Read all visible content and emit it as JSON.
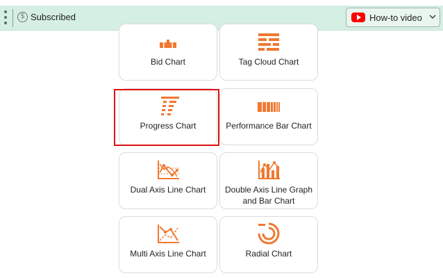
{
  "topbar": {
    "subscribed_label": "Subscribed",
    "subscribed_icon_glyph": "$",
    "howto_label": "How-to video"
  },
  "colors": {
    "accent": "#f07830",
    "topbar_bg": "#d5efe2",
    "selection": "#e01010",
    "youtube": "#ff0000"
  },
  "charts": [
    {
      "label": "Bid Chart",
      "icon": "bid-chart-icon"
    },
    {
      "label": "Tag Cloud Chart",
      "icon": "tag-cloud-chart-icon"
    },
    {
      "label": "Progress Chart",
      "icon": "progress-chart-icon",
      "selected": true
    },
    {
      "label": "Performance Bar Chart",
      "icon": "performance-bar-chart-icon"
    },
    {
      "label": "Dual Axis Line Chart",
      "icon": "dual-axis-line-chart-icon"
    },
    {
      "label": "Double Axis Line Graph and Bar Chart",
      "icon": "double-axis-line-bar-chart-icon"
    },
    {
      "label": "Multi Axis Line Chart",
      "icon": "multi-axis-line-chart-icon"
    },
    {
      "label": "Radial Chart",
      "icon": "radial-chart-icon"
    }
  ]
}
